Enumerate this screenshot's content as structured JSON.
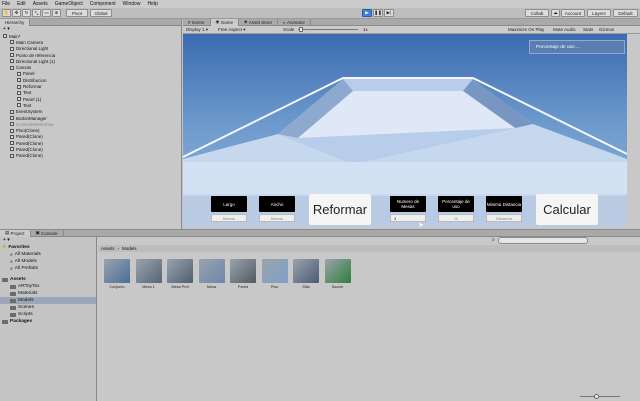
{
  "menu": [
    "File",
    "Edit",
    "Assets",
    "GameObject",
    "Component",
    "Window",
    "Help"
  ],
  "toolbar": {
    "pivot": "Pivot",
    "local": "Global",
    "collab": "Collab",
    "account": "Account",
    "layers": "Layers",
    "layout": "Default"
  },
  "hierarchy": {
    "tab": "Hierarchy",
    "items": [
      {
        "label": "Main*",
        "indent": 0
      },
      {
        "label": "Main Camera",
        "indent": 1
      },
      {
        "label": "Directional Light",
        "indent": 1
      },
      {
        "label": "Punto de referencia",
        "indent": 1
      },
      {
        "label": "Directional Light (1)",
        "indent": 1
      },
      {
        "label": "Canvas",
        "indent": 1
      },
      {
        "label": "Panel",
        "indent": 2
      },
      {
        "label": "Distribucion",
        "indent": 2
      },
      {
        "label": "Reformar",
        "indent": 2
      },
      {
        "label": "Text",
        "indent": 2
      },
      {
        "label": "Panel (1)",
        "indent": 2
      },
      {
        "label": "Text",
        "indent": 2
      },
      {
        "label": "EventSystem",
        "indent": 1
      },
      {
        "label": "ButtonManager",
        "indent": 1
      },
      {
        "label": "ControlesReformar",
        "indent": 1
      },
      {
        "label": "Piso(Clone)",
        "indent": 1
      },
      {
        "label": "Pared(Clone)",
        "indent": 1
      },
      {
        "label": "Pared(Clone)",
        "indent": 1
      },
      {
        "label": "Pared(Clone)",
        "indent": 1
      },
      {
        "label": "Pared(Clone)",
        "indent": 1
      }
    ]
  },
  "game": {
    "tabs": [
      "Scene",
      "Game",
      "Asset Store",
      "Animator"
    ],
    "display": "Display 1",
    "aspect": "Free Aspect",
    "scale_label": "Scale",
    "scale_value": "1x",
    "options": [
      "Maximize On Play",
      "Mute Audio",
      "Stats",
      "Gizmos"
    ],
    "tooltip": "Porcentaje de uso ...",
    "ui": {
      "largo": "Largo",
      "largo_ph": "Metros",
      "ancho": "Ancho",
      "ancho_ph": "Metros",
      "reformar": "Reformar",
      "mesas": "Numero de Mesas",
      "mesas_value": "3",
      "uso": "Porcentaje de uso",
      "uso_ph": "%",
      "distancia": "Minima Distancia",
      "distancia_ph": "Distancia",
      "calcular": "Calcular"
    }
  },
  "project": {
    "tabs": [
      "Project",
      "Console"
    ],
    "favorites": "Favorites",
    "fav_items": [
      "All Materials",
      "All Models",
      "All Prefabs"
    ],
    "assets": "Assets",
    "folders": [
      "ARToyTex",
      "Materials",
      "Models",
      "Scenes",
      "Scripts"
    ],
    "packages": "Packages",
    "breadcrumb": [
      "Assets",
      "Models"
    ],
    "items": [
      {
        "label": "Conjunto",
        "color": "#4a6d99"
      },
      {
        "label": "Mesa 1",
        "color": "#556677"
      },
      {
        "label": "Mesa Prof",
        "color": "#4e5e70"
      },
      {
        "label": "Mesa",
        "color": "#6c87ad"
      },
      {
        "label": "Pared",
        "color": "#505a63"
      },
      {
        "label": "Piso",
        "color": "#7ea0c6"
      },
      {
        "label": "Silla",
        "color": "#4a5b72"
      },
      {
        "label": "Soccer",
        "color": "#2f7f3a"
      }
    ]
  }
}
